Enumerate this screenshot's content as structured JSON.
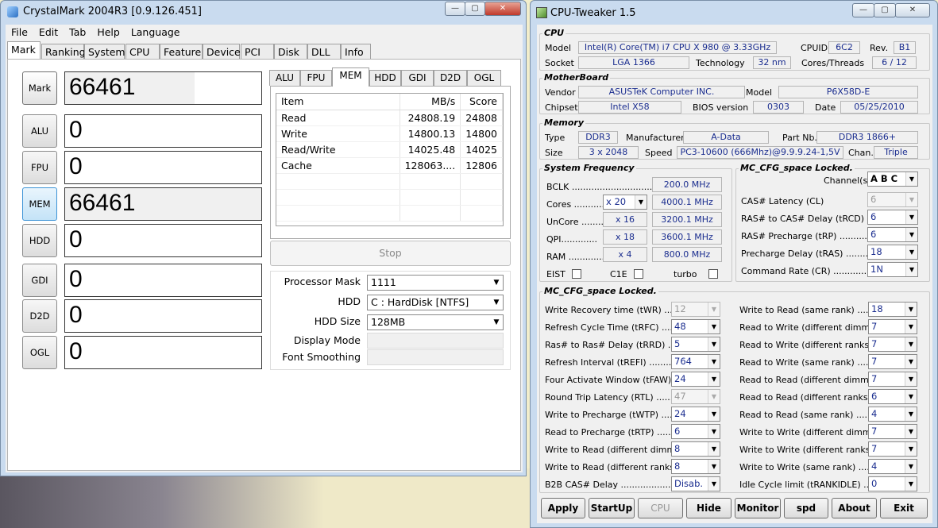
{
  "crystal": {
    "title": "CrystalMark 2004R3 [0.9.126.451]",
    "menu": [
      "File",
      "Edit",
      "Tab",
      "Help",
      "Language"
    ],
    "tabs": [
      "Mark",
      "Ranking",
      "System",
      "CPU",
      "Feature",
      "Device",
      "PCI",
      "Disk",
      "DLL",
      "Info"
    ],
    "active_tab": "Mark",
    "side": [
      {
        "label": "Mark",
        "score": "66461"
      },
      {
        "label": "ALU",
        "score": "0"
      },
      {
        "label": "FPU",
        "score": "0"
      },
      {
        "label": "MEM",
        "score": "66461"
      },
      {
        "label": "HDD",
        "score": "0"
      },
      {
        "label": "GDI",
        "score": "0"
      },
      {
        "label": "D2D",
        "score": "0"
      },
      {
        "label": "OGL",
        "score": "0"
      }
    ],
    "subtabs": [
      "ALU",
      "FPU",
      "MEM",
      "HDD",
      "GDI",
      "D2D",
      "OGL"
    ],
    "active_subtab": "MEM",
    "mem_table": {
      "headers": [
        "Item",
        "MB/s",
        "Score"
      ],
      "rows": [
        [
          "Read",
          "24808.19",
          "24808"
        ],
        [
          "Write",
          "14800.13",
          "14800"
        ],
        [
          "Read/Write",
          "14025.48",
          "14025"
        ],
        [
          "Cache",
          "128063....",
          "12806"
        ]
      ]
    },
    "stop_label": "Stop",
    "form": {
      "processor_mask_label": "Processor Mask",
      "processor_mask": "1111",
      "hdd_label": "HDD",
      "hdd": "C : HardDisk [NTFS]",
      "hdd_size_label": "HDD Size",
      "hdd_size": "128MB",
      "display_mode_label": "Display Mode",
      "font_smoothing_label": "Font Smoothing"
    }
  },
  "tweaker": {
    "title": "CPU-Tweaker 1.5",
    "cpu": {
      "group": "CPU",
      "model_label": "Model",
      "model": "Intel(R) Core(TM) i7 CPU      X 980  @ 3.33GHz",
      "cpuid_label": "CPUID",
      "cpuid": "6C2",
      "rev_label": "Rev.",
      "rev": "B1",
      "socket_label": "Socket",
      "socket": "LGA 1366",
      "tech_label": "Technology",
      "tech": "32 nm",
      "cores_label": "Cores/Threads",
      "cores": "6 / 12"
    },
    "mb": {
      "group": "MotherBoard",
      "vendor_label": "Vendor",
      "vendor": "ASUSTeK Computer INC.",
      "model_label": "Model",
      "model": "P6X58D-E",
      "chipset_label": "Chipset",
      "chipset": "Intel X58",
      "bios_label": "BIOS version",
      "bios": "0303",
      "date_label": "Date",
      "date": "05/25/2010"
    },
    "mem": {
      "group": "Memory",
      "type_label": "Type",
      "type": "DDR3",
      "manu_label": "Manufacturer",
      "manu": "A-Data",
      "part_label": "Part Nb.",
      "part": "DDR3 1866+",
      "size_label": "Size",
      "size": "3 x 2048",
      "speed_label": "Speed",
      "speed": "PC3-10600 (666Mhz)@9.9.9.24-1,5V",
      "chan_label": "Chan.",
      "chan": "Triple"
    },
    "freq": {
      "group": "System Frequency",
      "bclk_label": "BCLK ..............................",
      "bclk": "200.0 MHz",
      "cores_label": "Cores ............",
      "cores_mult": "x 20",
      "cores": "4000.1 MHz",
      "uncore_label": "UnCore ...........",
      "uncore_mult": "x 16",
      "uncore": "3200.1 MHz",
      "qpi_label": "QPI.............",
      "qpi_mult": "x 18",
      "qpi": "3600.1 MHz",
      "ram_label": "RAM ...............",
      "ram_mult": "x 4",
      "ram": "800.0 MHz",
      "eist": "EIST",
      "c1e": "C1E",
      "turbo": "turbo"
    },
    "mc1": {
      "group": "MC_CFG_space Locked.",
      "channels_label": "Channel(s)",
      "channels": "A B C",
      "rows": [
        {
          "label": "CAS# Latency (CL)",
          "value": "6",
          "disabled": true
        },
        {
          "label": "RAS# to CAS# Delay (tRCD)",
          "value": "6"
        },
        {
          "label": "RAS# Precharge (tRP) ..........",
          "value": "6"
        },
        {
          "label": "Precharge Delay (tRAS) ..........",
          "value": "18"
        },
        {
          "label": "Command Rate (CR) ..............",
          "value": "1N"
        }
      ]
    },
    "mc2": {
      "group": "MC_CFG_space Locked.",
      "left": [
        {
          "label": "Write Recovery time (tWR) ......",
          "value": "12",
          "disabled": true
        },
        {
          "label": "Refresh Cycle Time (tRFC) .......",
          "value": "48"
        },
        {
          "label": "Ras# to Ras# Delay (tRRD) .......",
          "value": "5"
        },
        {
          "label": "Refresh Interval (tREFI) ...........",
          "value": "764"
        },
        {
          "label": "Four Activate Window (tFAW) .....",
          "value": "24"
        },
        {
          "label": "Round Trip Latency (RTL) ........",
          "value": "47",
          "disabled": true
        },
        {
          "label": "Write to Precharge (tWTP) .......",
          "value": "24"
        },
        {
          "label": "Read to Precharge (tRTP) ........",
          "value": "6"
        },
        {
          "label": "Write to Read (different dimms) ..",
          "value": "8"
        },
        {
          "label": "Write to Read (different ranks) ..",
          "value": "8"
        },
        {
          "label": "B2B CAS# Delay ....................",
          "value": "Disab."
        }
      ],
      "right": [
        {
          "label": "Write to Read (same rank) ..........",
          "value": "18"
        },
        {
          "label": "Read to Write (different dimms) ....",
          "value": "7"
        },
        {
          "label": "Read to Write (different ranks) ....",
          "value": "7"
        },
        {
          "label": "Read to Write (same rank) ..........",
          "value": "7"
        },
        {
          "label": "Read to Read (different dimms) ....",
          "value": "7"
        },
        {
          "label": "Read to Read (different ranks) ....",
          "value": "6"
        },
        {
          "label": "Read to Read (same rank) ..........",
          "value": "4"
        },
        {
          "label": "Write to Write (different dimms) ...",
          "value": "7"
        },
        {
          "label": "Write to Write (different ranks) ...",
          "value": "7"
        },
        {
          "label": "Write to Write (same rank) ..........",
          "value": "4"
        },
        {
          "label": "Idle Cycle limit (tRANKIDLE) .......",
          "value": "0"
        }
      ]
    },
    "buttons": [
      "Apply",
      "StartUp",
      "CPU",
      "Hide",
      "Monitor",
      "spd",
      "About",
      "Exit"
    ]
  }
}
